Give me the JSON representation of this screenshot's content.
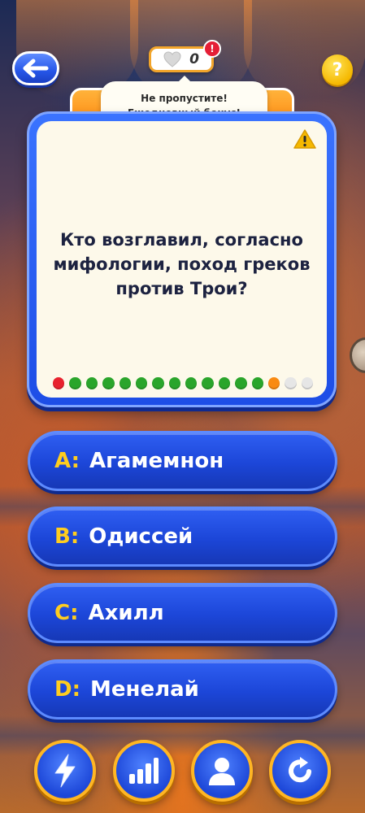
{
  "header": {
    "hearts_count": "0",
    "alert_badge": "!",
    "help_label": "?"
  },
  "tooltip": {
    "line1": "Не пропустите!",
    "line2": "Ежедневный бонус!"
  },
  "question": {
    "text": "Кто возглавил, согласно мифологии, поход греков против Трои?",
    "progress": [
      "red",
      "green",
      "green",
      "green",
      "green",
      "green",
      "green",
      "green",
      "green",
      "green",
      "green",
      "green",
      "green",
      "orange",
      "white",
      "white"
    ]
  },
  "answers": [
    {
      "letter": "A:",
      "text": "Агамемнон"
    },
    {
      "letter": "B:",
      "text": "Одиссей"
    },
    {
      "letter": "C:",
      "text": "Ахилл"
    },
    {
      "letter": "D:",
      "text": "Менелай"
    }
  ],
  "lifelines": [
    {
      "icon": "lightning-icon"
    },
    {
      "icon": "bar-chart-icon"
    },
    {
      "icon": "person-icon"
    },
    {
      "icon": "refresh-icon"
    }
  ],
  "colors": {
    "red": "#e8222e",
    "green": "#2aa52b",
    "orange": "#f98a12",
    "white": "#e6e6e6",
    "answer_letter": "#ffcd1f",
    "card_frame": "#2d63f5",
    "lifeline_ring": "#ffb623"
  }
}
